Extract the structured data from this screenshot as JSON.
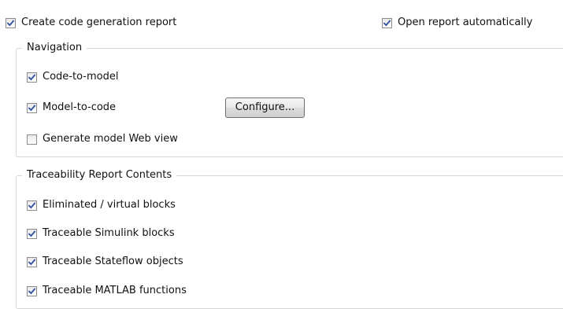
{
  "options": {
    "create_report": {
      "label": "Create code generation report",
      "checked": true
    },
    "open_report": {
      "label": "Open report automatically",
      "checked": true
    }
  },
  "navigation": {
    "title": "Navigation",
    "code_to_model": {
      "label": "Code-to-model",
      "checked": true
    },
    "model_to_code": {
      "label": "Model-to-code",
      "checked": true
    },
    "configure_label": "Configure...",
    "web_view": {
      "label": "Generate model Web view",
      "checked": false
    }
  },
  "traceability": {
    "title": "Traceability Report Contents",
    "eliminated": {
      "label": "Eliminated / virtual blocks",
      "checked": true
    },
    "simulink": {
      "label": "Traceable Simulink blocks",
      "checked": true
    },
    "stateflow": {
      "label": "Traceable Stateflow objects",
      "checked": true
    },
    "matlab": {
      "label": "Traceable MATLAB functions",
      "checked": true
    }
  },
  "colors": {
    "checkmark": "#2f4fa3",
    "checkbox_border": "#8a8a8a",
    "group_border": "#d6d6d6"
  }
}
